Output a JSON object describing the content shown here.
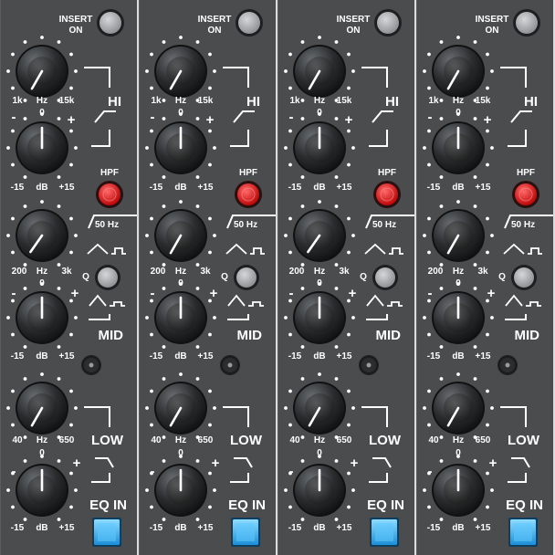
{
  "colors": {
    "panel": "#4a4c4e",
    "divider": "#dcdcdc",
    "text": "#ffffff",
    "hpf_led": "#e02020",
    "eq_in_button": "#3fb2f0",
    "insert_button": "#a9abae"
  },
  "strip_template": {
    "insert_line1": "INSERT",
    "insert_line2": "ON",
    "hi": {
      "min": "1k",
      "unit": "Hz",
      "max": "15k",
      "name": "HI"
    },
    "hi_gain": {
      "minus": "-",
      "zero": "0",
      "plus": "+",
      "min": "-15",
      "unit": "dB",
      "max": "+15"
    },
    "hpf": {
      "name": "HPF",
      "freq": "50 Hz"
    },
    "mid_freq": {
      "min": "200",
      "unit": "Hz",
      "max": "3k"
    },
    "q_label": "Q",
    "mid_gain": {
      "minus": "-",
      "zero": "0",
      "plus": "+",
      "min": "-15",
      "unit": "dB",
      "max": "+15",
      "name": "MID"
    },
    "low": {
      "min": "40",
      "unit": "Hz",
      "max": "650",
      "name": "LOW"
    },
    "low_gain": {
      "minus": "-",
      "zero": "0",
      "plus": "+",
      "min": "-15",
      "unit": "dB",
      "max": "+15"
    },
    "eq_in_label": "EQ IN"
  },
  "strips": [
    {
      "id": 1,
      "knob_angles": [
        -150,
        0,
        -145,
        0,
        -150,
        0
      ]
    },
    {
      "id": 2,
      "knob_angles": [
        -150,
        0,
        -150,
        0,
        -150,
        0
      ]
    },
    {
      "id": 3,
      "knob_angles": [
        -150,
        0,
        -145,
        0,
        -150,
        0
      ]
    },
    {
      "id": 4,
      "knob_angles": [
        -150,
        0,
        -150,
        0,
        -150,
        0
      ]
    }
  ]
}
